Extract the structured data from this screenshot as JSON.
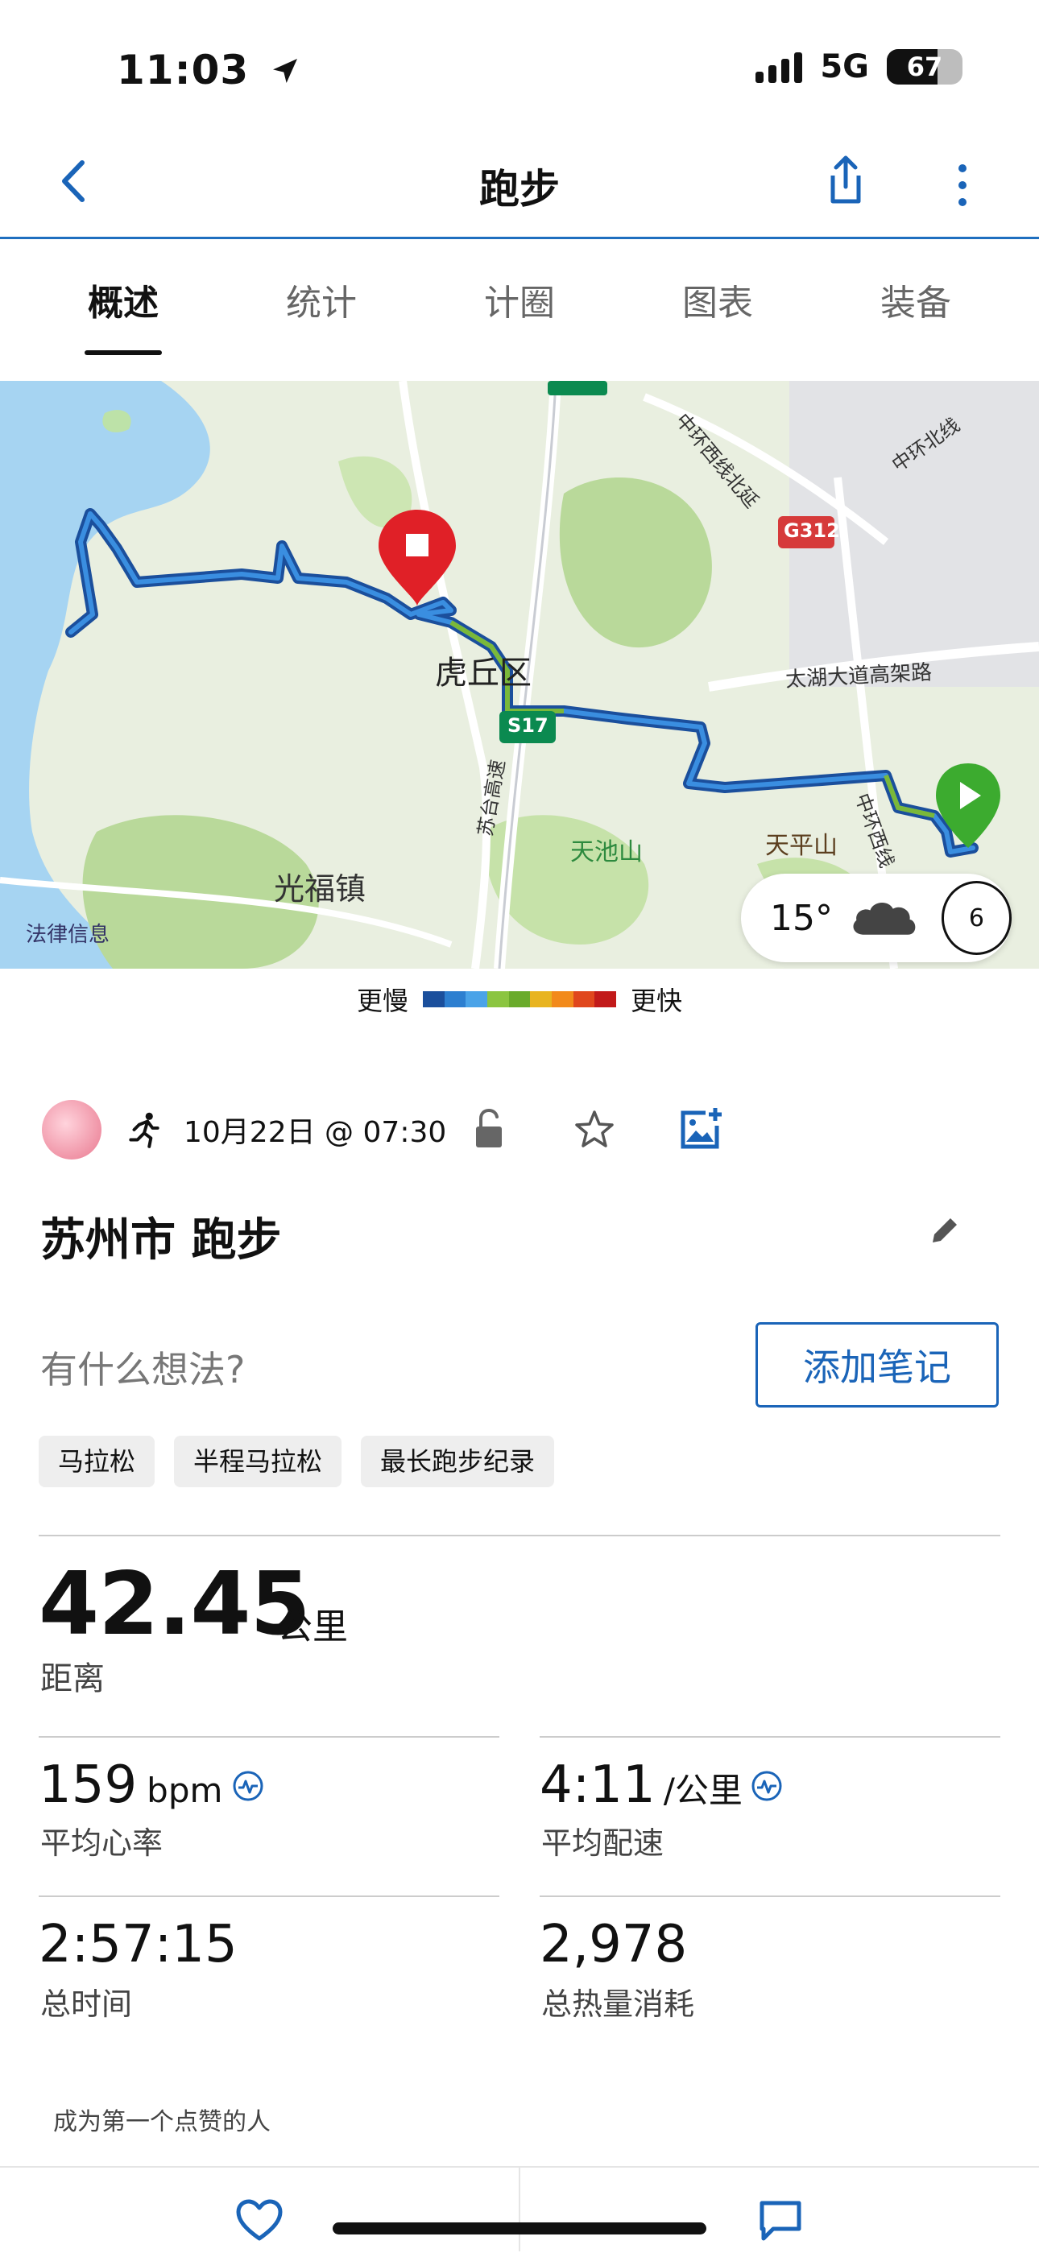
{
  "status_bar": {
    "time": "11:03",
    "network": "5G",
    "battery": "67"
  },
  "header": {
    "title": "跑步",
    "back_icon": "chevron-left-icon",
    "share_icon": "share-icon",
    "more_icon": "more-vertical-icon"
  },
  "tabs": [
    {
      "label": "概述",
      "active": true
    },
    {
      "label": "统计",
      "active": false
    },
    {
      "label": "计圈",
      "active": false
    },
    {
      "label": "图表",
      "active": false
    },
    {
      "label": "装备",
      "active": false
    }
  ],
  "map": {
    "labels": {
      "district": "虎丘区",
      "town": "光福镇",
      "mountain1": "天池山",
      "mountain2": "天平山",
      "road1": "太湖大道高架路",
      "road2": "中环西线",
      "road3": "中环北线",
      "road4": "中环西线北延",
      "road5": "苏台高速",
      "shield1": "S17",
      "shield2": "G312",
      "legal": "法律信息"
    },
    "weather": {
      "temp": "15°",
      "wind": "6"
    }
  },
  "pace_legend": {
    "slower": "更慢",
    "faster": "更快",
    "colors": [
      "#1b4f9c",
      "#2d7fd0",
      "#4aa3e8",
      "#8bc540",
      "#6aab2b",
      "#e8b420",
      "#f28a1b",
      "#e0471d",
      "#c21a1a"
    ]
  },
  "activity": {
    "datetime": "10月22日 @ 07:30",
    "title": "苏州市 跑步",
    "thoughts_placeholder": "有什么想法?",
    "add_note": "添加笔记",
    "badges": [
      "马拉松",
      "半程马拉松",
      "最长跑步纪录"
    ]
  },
  "stats": {
    "distance": {
      "value": "42.45",
      "unit": "公里",
      "label": "距离"
    },
    "avg_hr": {
      "value": "159",
      "unit": "bpm",
      "label": "平均心率"
    },
    "avg_pace": {
      "value": "4:11",
      "unit": "/公里",
      "label": "平均配速"
    },
    "total_time": {
      "value": "2:57:15",
      "label": "总时间"
    },
    "calories": {
      "value": "2,978",
      "label": "总热量消耗"
    }
  },
  "likes_text": "成为第一个点赞的人",
  "bottom_bar": {
    "like_icon": "heart-icon",
    "comment_icon": "comment-icon"
  }
}
